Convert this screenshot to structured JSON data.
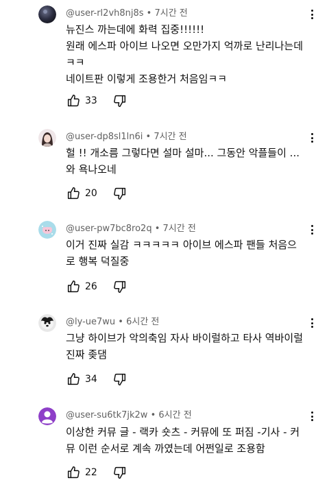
{
  "comments": [
    {
      "author": "@user-rl2vh8nj8s",
      "time": "7시간 전",
      "lines": [
        "뉴진스 까는데에 화력 집중!!!!!!",
        "원래 에스파 아이브 나오면 오만가지 억까로 난리나는데",
        "ㅋㅋ",
        "네이트판 이렇게 조용한거 처음임ㅋㅋ"
      ],
      "likes": "33",
      "avatar": "dark-sphere"
    },
    {
      "author": "@user-dp8sl1ln6i",
      "time": "7시간 전",
      "lines": [
        "헐 !! 개소름 그렇다면 설마 설마... 그동안 악플들이  ...",
        "와 욕나오네"
      ],
      "likes": "20",
      "avatar": "girl-photo"
    },
    {
      "author": "@user-pw7bc8ro2q",
      "time": "7시간 전",
      "lines": [
        "이거 진짜 실감 ㅋㅋㅋㅋㅋ 아이브 에스파 팬들 처음으",
        "로 행복 덕질중"
      ],
      "likes": "26",
      "avatar": "pink-creature"
    },
    {
      "author": "@ly-ue7wu",
      "time": "6시간 전",
      "lines": [
        "그냥 하이브가 악의축임 자사 바이럴하고 타사 역바이럴",
        "진짜 좆댐"
      ],
      "likes": "34",
      "avatar": "dog-photo"
    },
    {
      "author": "@user-su6tk7jk2w",
      "time": "6시간 전",
      "lines": [
        "이상한 커뮤 글 - 랙카 숏츠 - 커뮤에 또 퍼짐 -기사 - 커",
        "뮤 이런 순서로 계속 까였는데 어쩐일로 조용함"
      ],
      "likes": "22",
      "avatar": "default-user"
    }
  ],
  "separator": " • ",
  "icons": {
    "like": "thumbs-up-icon",
    "dislike": "thumbs-down-icon",
    "menu": "more-vert-icon"
  },
  "colors": {
    "meta": "#606060",
    "text": "#0f0f0f",
    "default_avatar": "#8e3fc8"
  }
}
